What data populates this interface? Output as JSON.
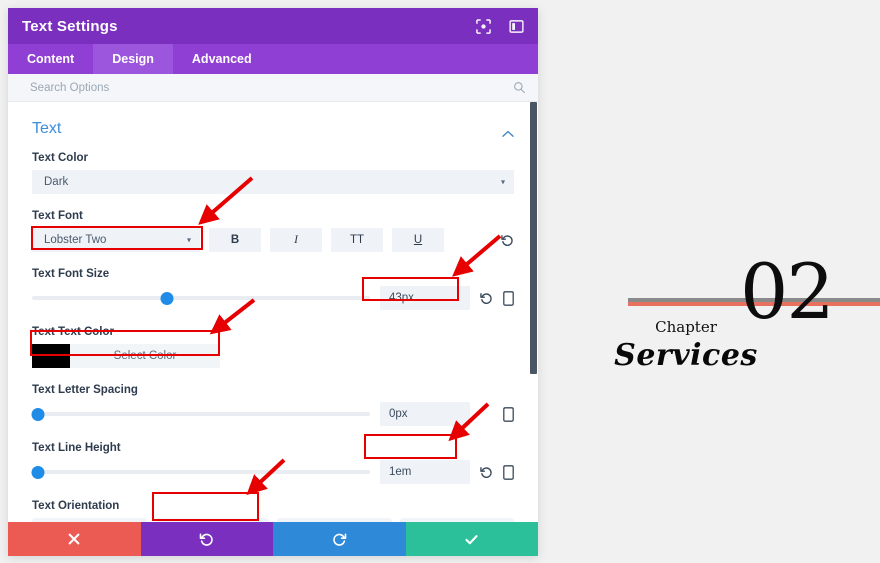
{
  "window": {
    "title": "Text Settings",
    "icons": [
      {
        "name": "focus-target-icon"
      },
      {
        "name": "layout-panel-icon"
      }
    ]
  },
  "tabs": [
    {
      "label": "Content",
      "active": false
    },
    {
      "label": "Design",
      "active": true
    },
    {
      "label": "Advanced",
      "active": false
    }
  ],
  "search": {
    "placeholder": "Search Options",
    "value": "",
    "icon": "search-icon"
  },
  "section": {
    "title": "Text",
    "collapse_icon": "chevron-up-icon"
  },
  "fields": {
    "text_color": {
      "label": "Text Color",
      "value": "Dark",
      "caret": "▾"
    },
    "text_font": {
      "label": "Text Font",
      "value": "Lobster Two",
      "caret": "▾",
      "format_buttons": [
        {
          "label": "B",
          "name": "bold-button"
        },
        {
          "label": "I",
          "name": "italic-button"
        },
        {
          "label": "TT",
          "name": "uppercase-button"
        },
        {
          "label": "U",
          "name": "underline-button"
        }
      ],
      "reset_icon": "reset-icon"
    },
    "text_font_size": {
      "label": "Text Font Size",
      "value": "43px",
      "slider_percent": 40,
      "reset_icon": "reset-icon",
      "device_icon": "mobile-icon"
    },
    "text_text_color": {
      "label": "Text Text Color",
      "button_label": "Select Color",
      "swatch_hex": "#000000"
    },
    "text_letter_spacing": {
      "label": "Text Letter Spacing",
      "value": "0px",
      "slider_percent": 0,
      "device_icon": "mobile-icon"
    },
    "text_line_height": {
      "label": "Text Line Height",
      "value": "1em",
      "slider_percent": 0,
      "reset_icon": "reset-icon",
      "device_icon": "mobile-icon"
    },
    "text_orientation": {
      "label": "Text Orientation",
      "options": [
        {
          "name": "align-left-button",
          "selected": false
        },
        {
          "name": "align-center-button",
          "selected": true
        },
        {
          "name": "align-right-button",
          "selected": false
        },
        {
          "name": "align-justify-button",
          "selected": false
        }
      ]
    }
  },
  "footer": {
    "buttons": [
      {
        "name": "cancel-button",
        "icon": "close-icon",
        "color": "#ec5a54"
      },
      {
        "name": "undo-button",
        "icon": "undo-icon",
        "color": "#7b2fbe"
      },
      {
        "name": "redo-button",
        "icon": "redo-icon",
        "color": "#2e8ad8"
      },
      {
        "name": "save-button",
        "icon": "check-icon",
        "color": "#2bbf9a"
      }
    ]
  },
  "preview": {
    "number": "02",
    "chapter_label": "Chapter",
    "title": "Services",
    "line_gray_hex": "#8a8a8a",
    "line_red_hex": "#e8705f"
  },
  "annotations": {
    "count": 5,
    "color": "#e60000",
    "targets": [
      "text-font-select",
      "text-font-size-value",
      "text-text-color-picker",
      "text-line-height-value",
      "text-orientation-center"
    ]
  }
}
